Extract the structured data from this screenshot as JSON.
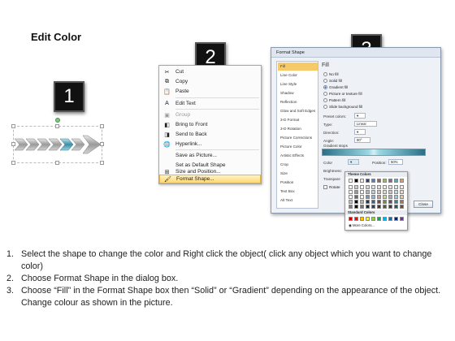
{
  "page": {
    "title": "Edit Color"
  },
  "badges": [
    "1",
    "2",
    "3"
  ],
  "context_menu": {
    "items": [
      {
        "icon": "scissors-icon",
        "glyph": "✂",
        "label": "Cut",
        "enabled": true
      },
      {
        "icon": "copy-icon",
        "glyph": "⧉",
        "label": "Copy",
        "enabled": true
      },
      {
        "icon": "paste-icon",
        "glyph": "📋",
        "label": "Paste",
        "enabled": true
      },
      {
        "icon": "edit-text-icon",
        "glyph": "A",
        "label": "Edit Text",
        "enabled": true
      },
      {
        "icon": "group-icon",
        "glyph": "▣",
        "label": "Group",
        "enabled": false
      },
      {
        "icon": "bring-to-front-icon",
        "glyph": "◧",
        "label": "Bring to Front",
        "enabled": true
      },
      {
        "icon": "send-to-back-icon",
        "glyph": "◨",
        "label": "Send to Back",
        "enabled": true
      },
      {
        "icon": "hyperlink-icon",
        "glyph": "🌐",
        "label": "Hyperlink...",
        "enabled": true
      },
      {
        "icon": "",
        "glyph": "",
        "label": "Save as Picture...",
        "enabled": true
      },
      {
        "icon": "",
        "glyph": "",
        "label": "Set as Default Shape",
        "enabled": true
      },
      {
        "icon": "size-position-icon",
        "glyph": "⊞",
        "label": "Size and Position...",
        "enabled": true
      },
      {
        "icon": "format-shape-icon",
        "glyph": "🖌",
        "label": "Format Shape...",
        "enabled": true,
        "highlighted": true
      }
    ]
  },
  "dialog": {
    "title": "Format Shape",
    "nav": [
      "Fill",
      "Line Color",
      "Line Style",
      "Shadow",
      "Reflection",
      "Glow and Soft Edges",
      "3-D Format",
      "3-D Rotation",
      "Picture Corrections",
      "Picture Color",
      "Artistic Effects",
      "Crop",
      "Size",
      "Position",
      "Text Box",
      "Alt Text"
    ],
    "nav_active": "Fill",
    "section_title": "Fill",
    "fill_options": [
      "No fill",
      "Solid fill",
      "Gradient fill",
      "Picture or texture fill",
      "Pattern fill",
      "Slide background fill"
    ],
    "fill_selected": "Gradient fill",
    "preset_colors_label": "Preset colors:",
    "type_label": "Type:",
    "type_value": "Linear",
    "direction_label": "Direction:",
    "angle_label": "Angle:",
    "angle_value": "90°",
    "gradient_stops_label": "Gradient stops",
    "color_label": "Color",
    "position_label": "Position:",
    "position_value": "50%",
    "brightness_label": "Brightness:",
    "transparency_label": "Transpare",
    "rotate_label": "Rotate",
    "close_label": "Close"
  },
  "palette": {
    "theme_label": "Theme Colors",
    "standard_label": "Standard Colors",
    "more_label": "More Colors...",
    "theme_top": [
      "#ffffff",
      "#000000",
      "#eeece1",
      "#1f497d",
      "#4f81bd",
      "#c0504d",
      "#9bbb59",
      "#8064a2",
      "#4bacc6",
      "#f79646"
    ],
    "standard": [
      "#c00000",
      "#ff0000",
      "#ffc000",
      "#ffff00",
      "#92d050",
      "#00b050",
      "#00b0f0",
      "#0070c0",
      "#002060",
      "#7030a0"
    ]
  },
  "instructions": [
    {
      "num": "1.",
      "text": "Select the shape to change the color and Right click the object( click any object which you want to change color)"
    },
    {
      "num": "2.",
      "text": "Choose Format Shape in the dialog box."
    },
    {
      "num": "3.",
      "text": "Choose “Fill” in the Format Shape box then “Solid” or “Gradient” depending on the appearance of the object. Change colour as shown in the picture."
    }
  ]
}
